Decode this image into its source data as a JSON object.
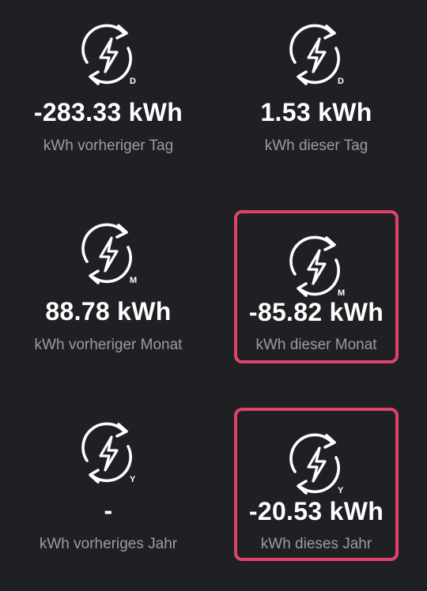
{
  "tiles": [
    {
      "badge": "D",
      "value": "-283.33 kWh",
      "label": "kWh vorheriger Tag",
      "highlighted": false
    },
    {
      "badge": "D",
      "value": "1.53 kWh",
      "label": "kWh dieser Tag",
      "highlighted": false
    },
    {
      "badge": "M",
      "value": "88.78 kWh",
      "label": "kWh vorheriger Monat",
      "highlighted": false
    },
    {
      "badge": "M",
      "value": "-85.82 kWh",
      "label": "kWh dieser Monat",
      "highlighted": true
    },
    {
      "badge": "Y",
      "value": "-",
      "label": "kWh vorheriges Jahr",
      "highlighted": false
    },
    {
      "badge": "Y",
      "value": "-20.53 kWh",
      "label": "kWh dieses Jahr",
      "highlighted": true
    }
  ],
  "icon": "energy-cycle-icon",
  "colors": {
    "background": "#1f2024",
    "value": "#ffffff",
    "label": "#9a9ca2",
    "highlight_border": "#e0436a"
  }
}
